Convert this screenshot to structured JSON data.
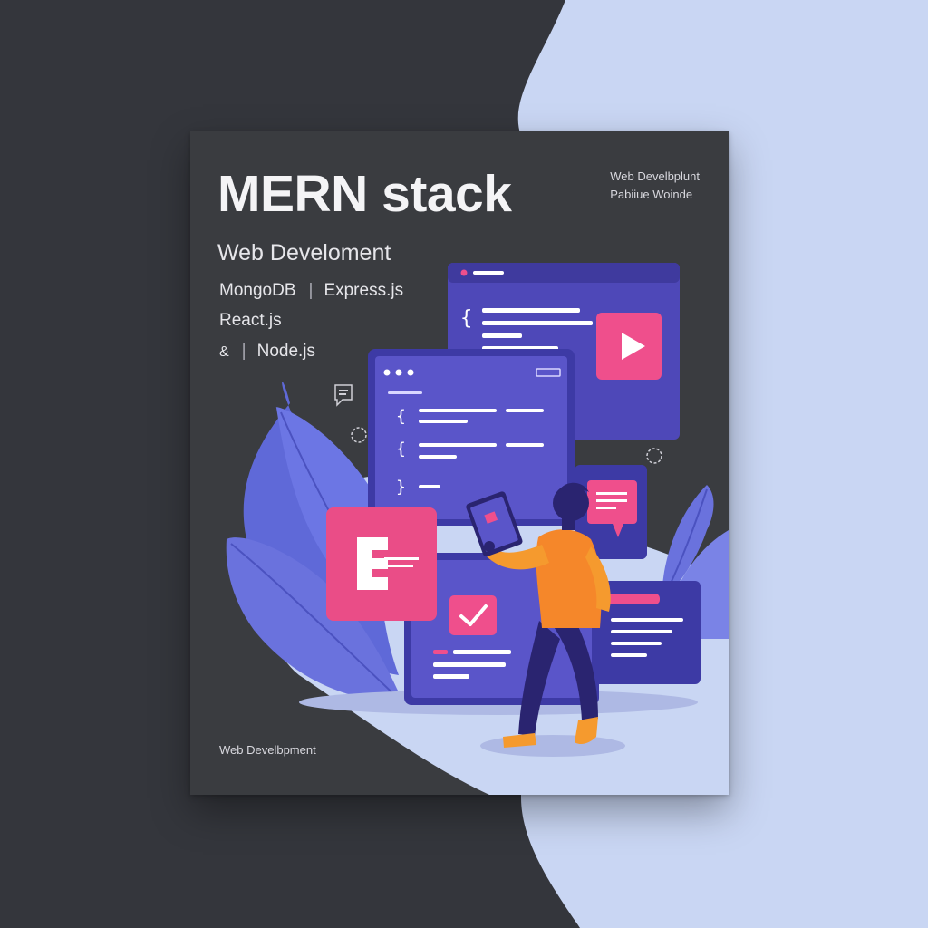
{
  "cover": {
    "title": "MERN stack",
    "publisher_line1": "Web Develbplunt",
    "publisher_line2": "Pabiiue Woinde",
    "subtitle": "Web Develoment",
    "tech": {
      "mongodb": "MongoDB",
      "separator": "|",
      "express": "Express.js",
      "react": "React.js",
      "ampersand": "&",
      "node": "Node.js"
    },
    "footer": "Web Develbpment"
  },
  "colors": {
    "background_dark": "#34363c",
    "background_light": "#c9d6f3",
    "cover_dark": "#3a3c40",
    "accent_purple": "#5b54c9",
    "accent_pink": "#ef4f8c",
    "accent_orange": "#f59a2e"
  },
  "icons": [
    "code-braces-icon",
    "play-icon",
    "check-icon",
    "chat-bubble-icon",
    "gear-icon",
    "ellipsis-dots-icon"
  ]
}
